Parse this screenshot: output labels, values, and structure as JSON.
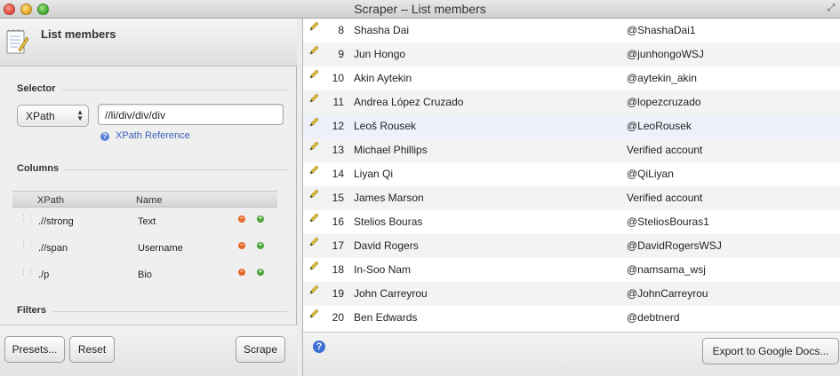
{
  "window": {
    "title": "Scraper – List members"
  },
  "left": {
    "title": "List members",
    "selector": {
      "section_label": "Selector",
      "type_value": "XPath",
      "path_value": "//li/div/div/div",
      "reference_link": "XPath Reference"
    },
    "columns": {
      "section_label": "Columns",
      "header_xpath": "XPath",
      "header_name": "Name",
      "rows": [
        {
          "xpath": ".//strong",
          "name": "Text"
        },
        {
          "xpath": ".//span",
          "name": "Username"
        },
        {
          "xpath": "./p",
          "name": "Bio"
        }
      ]
    },
    "filters": {
      "section_label": "Filters"
    },
    "footer": {
      "presets": "Presets...",
      "reset": "Reset",
      "scrape": "Scrape"
    }
  },
  "results": {
    "rows": [
      {
        "num": "8",
        "name": "Shasha Dai",
        "handle": "@ShashaDai1"
      },
      {
        "num": "9",
        "name": "Jun Hongo",
        "handle": "@junhongoWSJ"
      },
      {
        "num": "10",
        "name": "Akin Aytekin",
        "handle": "@aytekin_akin"
      },
      {
        "num": "11",
        "name": "Andrea López Cruzado",
        "handle": "@lopezcruzado"
      },
      {
        "num": "12",
        "name": "Leoš Rousek",
        "handle": "@LeoRousek"
      },
      {
        "num": "13",
        "name": "Michael Phillips",
        "handle": "Verified account"
      },
      {
        "num": "14",
        "name": "Liyan Qi",
        "handle": "@QiLiyan"
      },
      {
        "num": "15",
        "name": "James Marson",
        "handle": "Verified account"
      },
      {
        "num": "16",
        "name": "Stelios Bouras",
        "handle": "@SteliosBouras1"
      },
      {
        "num": "17",
        "name": "David Rogers",
        "handle": "@DavidRogersWSJ"
      },
      {
        "num": "18",
        "name": "In-Soo Nam",
        "handle": "@namsama_wsj"
      },
      {
        "num": "19",
        "name": "John Carreyrou",
        "handle": "@JohnCarreyrou"
      },
      {
        "num": "20",
        "name": "Ben Edwards",
        "handle": "@debtnerd"
      }
    ],
    "export_button": "Export to Google Docs...",
    "help_symbol": "?"
  },
  "colors": {
    "row_alt": "#f3f3f3",
    "row_selected": "#eef0fa",
    "link": "#3b5fb7",
    "remove_dot": "#e86a2a",
    "add_dot": "#4aa43a"
  }
}
